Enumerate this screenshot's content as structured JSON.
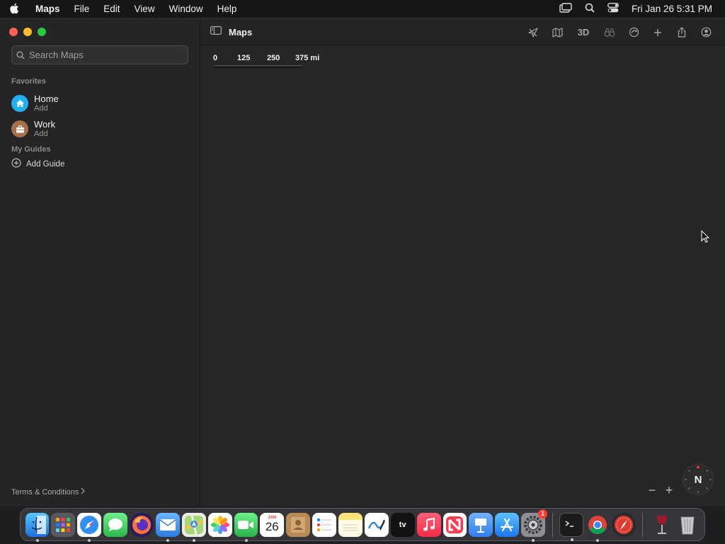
{
  "menubar": {
    "app_name": "Maps",
    "menus": [
      "File",
      "Edit",
      "View",
      "Window",
      "Help"
    ],
    "clock": "Fri Jan 26  5:31 PM"
  },
  "window": {
    "title": "Maps"
  },
  "search": {
    "placeholder": "Search Maps"
  },
  "sidebar": {
    "favorites_header": "Favorites",
    "favorites": [
      {
        "name": "Home",
        "sub": "Add",
        "icon": "house-icon",
        "color": "#1fb1f2"
      },
      {
        "name": "Work",
        "sub": "Add",
        "icon": "briefcase-icon",
        "color": "#a8704a"
      }
    ],
    "guides_header": "My Guides",
    "add_guide": "Add Guide",
    "terms": "Terms & Conditions"
  },
  "toolbar": {
    "btn_3d": "3D",
    "tools": [
      "location-arrow-icon",
      "map-icon",
      "3d-toggle",
      "look-around-icon",
      "tracking-icon",
      "add-icon",
      "share-icon",
      "account-icon"
    ]
  },
  "map": {
    "scale_labels": [
      "0",
      "125",
      "250",
      "375 mi"
    ],
    "compass_label": "N",
    "zoom_out": "−",
    "zoom_in": "+"
  },
  "dock": {
    "calendar_month": "JAN",
    "calendar_day": "26",
    "appletv_label": "tv",
    "settings_badge": "1",
    "apps": [
      {
        "name": "finder",
        "color": "#1e8cf2",
        "running": true
      },
      {
        "name": "launchpad",
        "color": "#6b7280",
        "running": false
      },
      {
        "name": "safari",
        "color": "#3b8ef0",
        "running": true
      },
      {
        "name": "messages",
        "color": "#34c759",
        "running": false
      },
      {
        "name": "firefox",
        "color": "#ff7139",
        "running": false
      },
      {
        "name": "mail",
        "color": "#4a90e2",
        "running": true
      },
      {
        "name": "maps",
        "color": "#5ac05a",
        "running": true
      },
      {
        "name": "photos",
        "color": "#f4b400",
        "running": false
      },
      {
        "name": "facetime",
        "color": "#32c25a",
        "running": true
      },
      {
        "name": "calendar",
        "color": "#ffffff",
        "running": false
      },
      {
        "name": "contacts",
        "color": "#b88a55",
        "running": false
      },
      {
        "name": "reminders",
        "color": "#ffffff",
        "running": false
      },
      {
        "name": "notes",
        "color": "#ffd84a",
        "running": false
      },
      {
        "name": "freeform",
        "color": "#ffffff",
        "running": false
      },
      {
        "name": "apple-tv",
        "color": "#111111",
        "running": false
      },
      {
        "name": "music",
        "color": "#fa3c55",
        "running": false
      },
      {
        "name": "news",
        "color": "#ff3a4f",
        "running": false
      },
      {
        "name": "keynote",
        "color": "#3f8cf1",
        "running": false
      },
      {
        "name": "app-store",
        "color": "#1a8cf5",
        "running": false
      },
      {
        "name": "system-settings",
        "color": "#8e8e93",
        "running": true
      },
      {
        "name": "terminal",
        "color": "#1c1c1c",
        "running": true
      },
      {
        "name": "chrome",
        "color": "#ffffff",
        "running": true
      },
      {
        "name": "compass-app",
        "color": "#e03a2e",
        "running": false
      },
      {
        "name": "wine",
        "color": "#f2f2f2",
        "running": false
      },
      {
        "name": "trash",
        "color": "#9c9ca0",
        "running": false
      }
    ]
  }
}
